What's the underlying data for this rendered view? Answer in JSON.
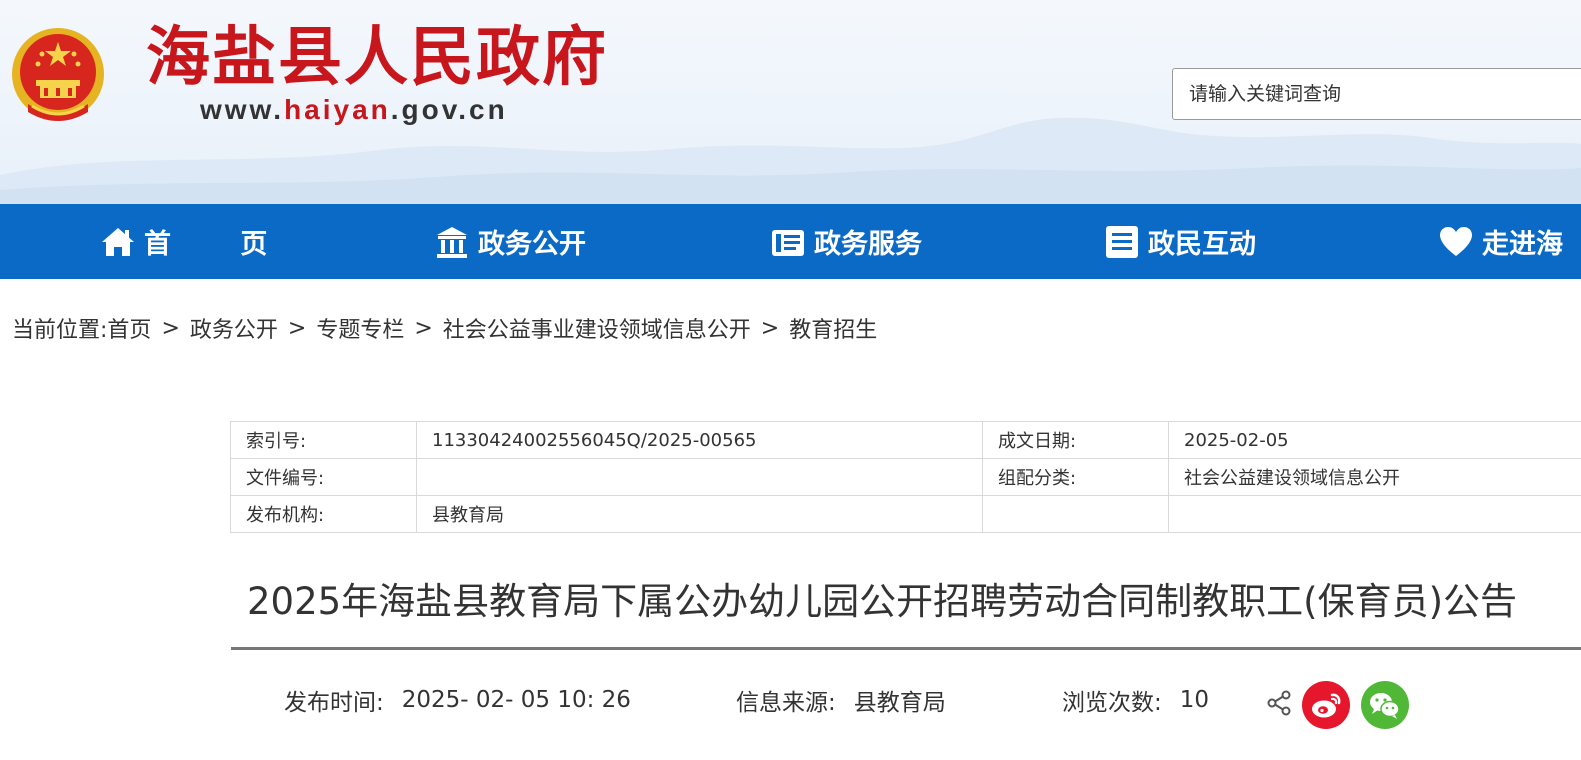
{
  "header": {
    "site_title": "海盐县人民政府",
    "site_url_prefix": "www.",
    "site_url_highlight": "haiyan",
    "site_url_suffix": ".gov.cn",
    "search_placeholder": "请输入关键词查询"
  },
  "nav": {
    "items": [
      {
        "label": "首 页",
        "icon": "home-icon"
      },
      {
        "label": "政务公开",
        "icon": "government-building-icon"
      },
      {
        "label": "政务服务",
        "icon": "service-document-icon"
      },
      {
        "label": "政民互动",
        "icon": "list-document-icon"
      },
      {
        "label": "走进海",
        "icon": "heart-icon"
      }
    ]
  },
  "breadcrumb": {
    "prefix": "当前位置:",
    "items": [
      "首页",
      "政务公开",
      "专题专栏",
      "社会公益事业建设领域信息公开",
      "教育招生"
    ],
    "separator": ">"
  },
  "meta": {
    "rows": [
      [
        "索引号:",
        "11330424002556045Q/2025-00565",
        "成文日期:",
        "2025-02-05"
      ],
      [
        "文件编号:",
        "",
        "组配分类:",
        "社会公益建设领域信息公开"
      ],
      [
        "发布机构:",
        "县教育局",
        "",
        ""
      ]
    ]
  },
  "article": {
    "title": "2025年海盐县教育局下属公办幼儿园公开招聘劳动合同制教职工(保育员)公告",
    "publish_time_label": "发布时间:",
    "publish_time": "2025- 02- 05 10: 26",
    "source_label": "信息来源:",
    "source": "县教育局",
    "views_label": "浏览次数:",
    "views": "10"
  },
  "colors": {
    "brand_red": "#c8161d",
    "nav_blue": "#0c6ac7",
    "weibo_red": "#e6162d",
    "wechat_green": "#50b836"
  }
}
